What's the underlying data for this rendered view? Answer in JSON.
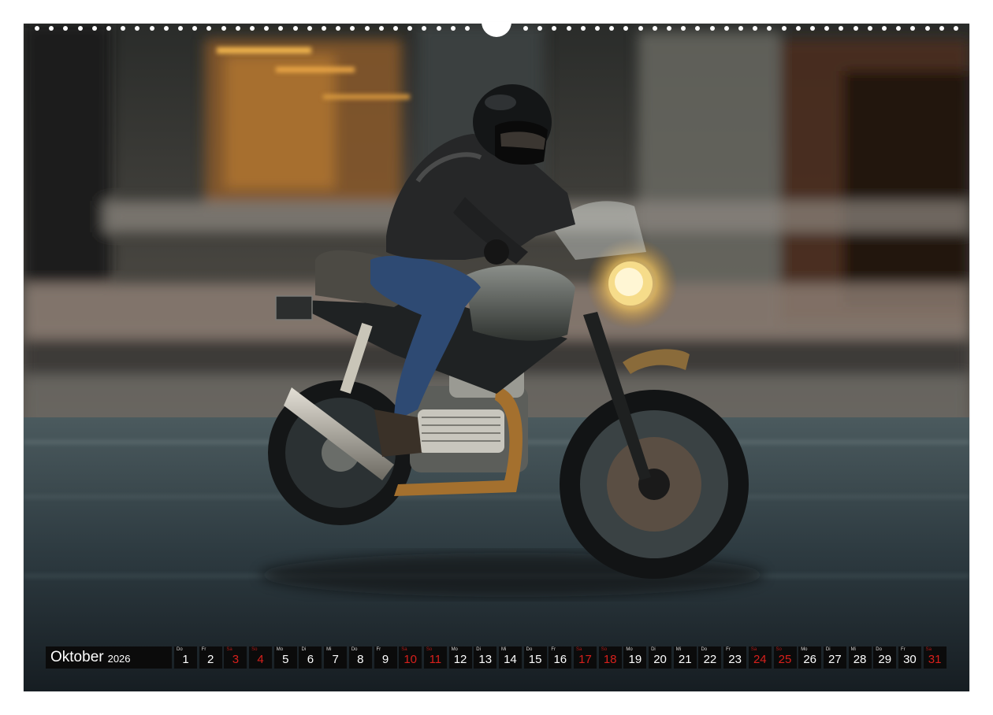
{
  "calendar": {
    "month": "Oktober",
    "year": "2026",
    "days": [
      {
        "wd": "Do",
        "n": "1",
        "red": false
      },
      {
        "wd": "Fr",
        "n": "2",
        "red": false
      },
      {
        "wd": "Sa",
        "n": "3",
        "red": true
      },
      {
        "wd": "So",
        "n": "4",
        "red": true
      },
      {
        "wd": "Mo",
        "n": "5",
        "red": false
      },
      {
        "wd": "Di",
        "n": "6",
        "red": false
      },
      {
        "wd": "Mi",
        "n": "7",
        "red": false
      },
      {
        "wd": "Do",
        "n": "8",
        "red": false
      },
      {
        "wd": "Fr",
        "n": "9",
        "red": false
      },
      {
        "wd": "Sa",
        "n": "10",
        "red": true
      },
      {
        "wd": "So",
        "n": "11",
        "red": true
      },
      {
        "wd": "Mo",
        "n": "12",
        "red": false
      },
      {
        "wd": "Di",
        "n": "13",
        "red": false
      },
      {
        "wd": "Mi",
        "n": "14",
        "red": false
      },
      {
        "wd": "Do",
        "n": "15",
        "red": false
      },
      {
        "wd": "Fr",
        "n": "16",
        "red": false
      },
      {
        "wd": "Sa",
        "n": "17",
        "red": true
      },
      {
        "wd": "So",
        "n": "18",
        "red": true
      },
      {
        "wd": "Mo",
        "n": "19",
        "red": false
      },
      {
        "wd": "Di",
        "n": "20",
        "red": false
      },
      {
        "wd": "Mi",
        "n": "21",
        "red": false
      },
      {
        "wd": "Do",
        "n": "22",
        "red": false
      },
      {
        "wd": "Fr",
        "n": "23",
        "red": false
      },
      {
        "wd": "Sa",
        "n": "24",
        "red": true
      },
      {
        "wd": "So",
        "n": "25",
        "red": true
      },
      {
        "wd": "Mo",
        "n": "26",
        "red": false
      },
      {
        "wd": "Di",
        "n": "27",
        "red": false
      },
      {
        "wd": "Mi",
        "n": "28",
        "red": false
      },
      {
        "wd": "Do",
        "n": "29",
        "red": false
      },
      {
        "wd": "Fr",
        "n": "30",
        "red": false
      },
      {
        "wd": "Sa",
        "n": "31",
        "red": true
      }
    ]
  },
  "colors": {
    "weekend_red": "#d8201c",
    "cell_background": "#0b0b0b",
    "page_border": "#ffffff"
  }
}
